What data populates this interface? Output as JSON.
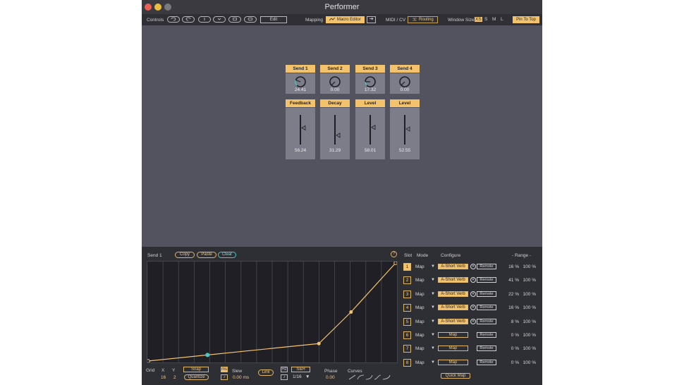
{
  "window": {
    "title": "Performer"
  },
  "toolbar": {
    "controls_label": "Controls",
    "edit_label": "Edit",
    "mapping_label": "Mapping",
    "macro_editor_label": "Macro Editor",
    "midi_cv_label": "MIDI / CV",
    "routing_label": "Routing",
    "window_size_label": "Window Size",
    "window_sizes": [
      "XS",
      "S",
      "M",
      "L"
    ],
    "window_size_selected": "XS",
    "pin_label": "Pin To Top"
  },
  "macros": {
    "sends": [
      {
        "label": "Send 1",
        "value": "24.41",
        "level": 0.2441
      },
      {
        "label": "Send 2",
        "value": "0.00",
        "level": 0.0
      },
      {
        "label": "Send 3",
        "value": "17.32",
        "level": 0.1732
      },
      {
        "label": "Send 4",
        "value": "0.00",
        "level": 0.0
      }
    ],
    "faders": [
      {
        "label": "Feedback",
        "value": "56.24",
        "level": 0.5624
      },
      {
        "label": "Decay",
        "value": "31.29",
        "level": 0.3129
      },
      {
        "label": "Level",
        "value": "58.01",
        "level": 0.5801
      },
      {
        "label": "Level",
        "value": "52.55",
        "level": 0.5255
      }
    ]
  },
  "editor": {
    "selected_macro": "Send 1",
    "copy_label": "Copy",
    "paste_label": "Paste",
    "clear_label": "Clear",
    "help_label": "?",
    "grid_label": "Grid",
    "x_label": "X",
    "y_label": "Y",
    "x_value": "16",
    "y_value": "2",
    "snap_label": "Snap",
    "quantize_label": "Quantize",
    "ms_label": "ms",
    "note_label": "♪",
    "slew_label": "Slew",
    "slew_value": "0.00 ms",
    "link_label": "Link",
    "hz_label": "Hz",
    "sh_label": "S&H",
    "note2_label": "♪",
    "rate_value": "1/16",
    "phase_label": "Phase",
    "phase_value": "0.00",
    "curves_label": "Curves",
    "curve_icons": [
      "linear-curve-icon",
      "ease-in-curve-icon",
      "ease-out-curve-icon",
      "s-curve-icon",
      "exp-curve-icon"
    ],
    "points": [
      {
        "x": 0.0,
        "y": 0.0,
        "type": "end"
      },
      {
        "x": 0.24,
        "y": 0.062,
        "type": "selected"
      },
      {
        "x": 0.69,
        "y": 0.178,
        "type": "normal"
      },
      {
        "x": 0.82,
        "y": 0.5,
        "type": "normal"
      },
      {
        "x": 1.0,
        "y": 1.0,
        "type": "end"
      }
    ],
    "grid_columns": 16
  },
  "slots": {
    "headers": {
      "slot": "Slot",
      "mode": "Mode",
      "configure": "Configure",
      "range": "- Range -"
    },
    "rows": [
      {
        "num": "1",
        "mode": "Map",
        "target": "A-Short Verb",
        "mapped": true,
        "remote": "Remote",
        "min": "16 %",
        "max": "100 %"
      },
      {
        "num": "2",
        "mode": "Map",
        "target": "A-Short Verb",
        "mapped": true,
        "remote": "Remote",
        "min": "41 %",
        "max": "100 %"
      },
      {
        "num": "3",
        "mode": "Map",
        "target": "A-Short Verb",
        "mapped": true,
        "remote": "Remote",
        "min": "22 %",
        "max": "100 %"
      },
      {
        "num": "4",
        "mode": "Map",
        "target": "A-Short Verb",
        "mapped": true,
        "remote": "Remote",
        "min": "16 %",
        "max": "100 %"
      },
      {
        "num": "5",
        "mode": "Map",
        "target": "A-Short Verb",
        "mapped": true,
        "remote": "Remote",
        "min": "8 %",
        "max": "100 %"
      },
      {
        "num": "6",
        "mode": "Map",
        "target": "Map",
        "mapped": false,
        "remote": "Remote",
        "min": "0 %",
        "max": "100 %"
      },
      {
        "num": "7",
        "mode": "Map",
        "target": "Map",
        "mapped": false,
        "remote": "Remote",
        "min": "0 %",
        "max": "100 %"
      },
      {
        "num": "8",
        "mode": "Map",
        "target": "Map",
        "mapped": false,
        "remote": "Remote",
        "min": "0 %",
        "max": "100 %"
      }
    ],
    "quick_map_label": "Quick Map"
  },
  "colors": {
    "accent": "#f3c26b",
    "selected_point": "#4ec7c4",
    "curve": "#f3c26b"
  }
}
